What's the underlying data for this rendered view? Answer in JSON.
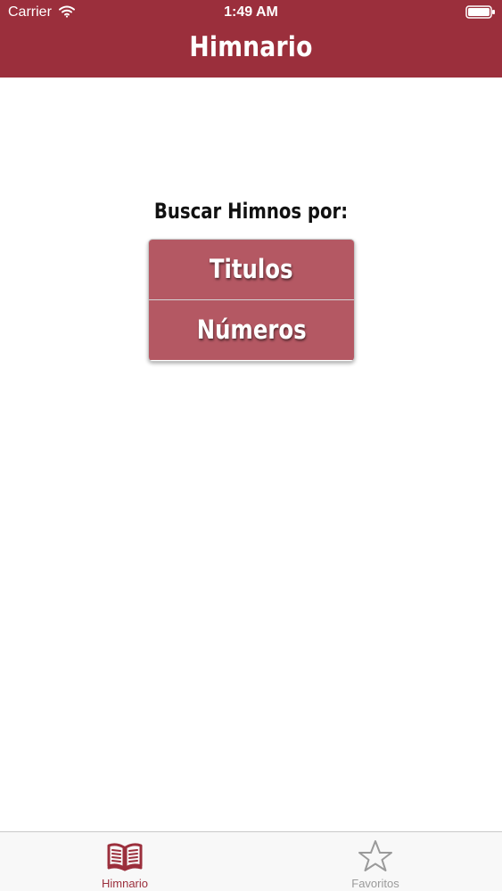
{
  "status_bar": {
    "carrier": "Carrier",
    "time": "1:49 AM"
  },
  "header": {
    "title": "Himnario"
  },
  "main": {
    "search_label": "Buscar Himnos por:",
    "buttons": [
      {
        "label": "Titulos"
      },
      {
        "label": "Números"
      }
    ]
  },
  "tab_bar": {
    "tabs": [
      {
        "label": "Himnario",
        "icon": "book-icon",
        "active": true
      },
      {
        "label": "Favoritos",
        "icon": "star-icon",
        "active": false
      }
    ]
  },
  "colors": {
    "accent": "#9b2f3c",
    "button": "#b45863",
    "tab_inactive": "#9a9a9a"
  }
}
